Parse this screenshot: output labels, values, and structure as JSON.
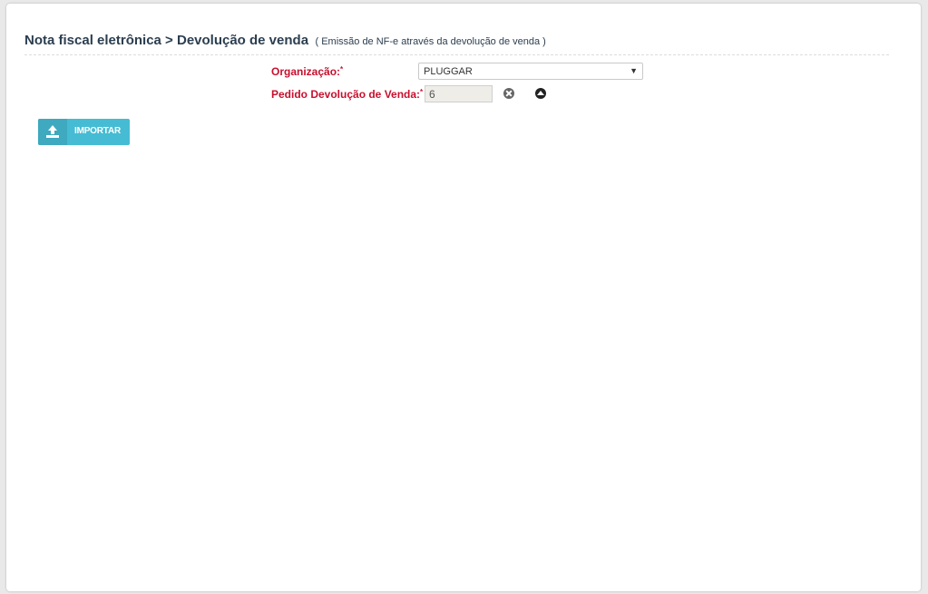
{
  "header": {
    "title": "Nota fiscal eletrônica > Devolução de venda",
    "subtitle": "( Emissão de NF-e através da devolução de venda )"
  },
  "form": {
    "organizacao": {
      "label": "Organização:",
      "required_mark": "*",
      "selected": "PLUGGAR",
      "arrow": "▼"
    },
    "pedido": {
      "label": "Pedido Devolução de Venda:",
      "required_mark": "*",
      "value": "6"
    }
  },
  "actions": {
    "import_label": "IMPORTAR",
    "import_icon": "upload-icon"
  },
  "colors": {
    "label_red": "#c8102e",
    "title_navy": "#2b3e50",
    "button_cyan": "#45bcd3"
  }
}
